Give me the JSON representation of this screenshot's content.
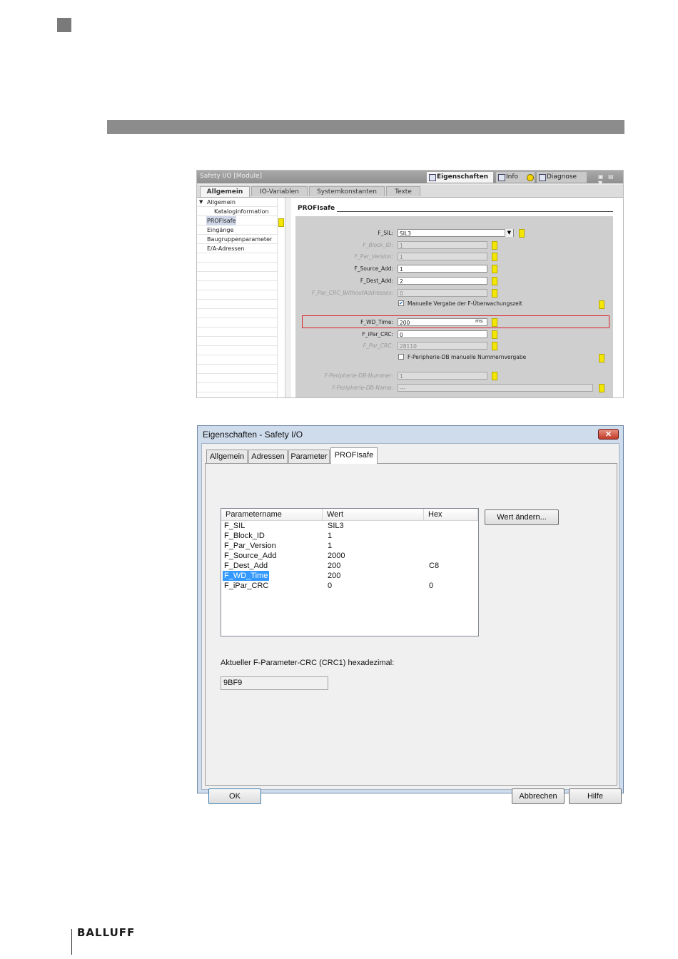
{
  "brand": "BALLUFF",
  "tia": {
    "title": "Safety I/O [Module]",
    "top_tabs": [
      "Eigenschaften",
      "Info",
      "Diagnose"
    ],
    "subtabs": [
      "Allgemein",
      "IO-Variablen",
      "Systemkonstanten",
      "Texte"
    ],
    "tree": [
      "Allgemein",
      "Kataloginformation",
      "PROFIsafe",
      "Eingänge",
      "Baugruppenparameter",
      "E/A-Adressen"
    ],
    "section": "PROFIsafe",
    "params": {
      "f_sil": {
        "label": "F_SIL:",
        "value": "SIL3"
      },
      "f_block_id": {
        "label": "F_Block_ID:",
        "value": "1"
      },
      "f_par_version": {
        "label": "F_Par_Version:",
        "value": "1"
      },
      "f_source_add": {
        "label": "F_Source_Add:",
        "value": "1"
      },
      "f_dest_add": {
        "label": "F_Dest_Add:",
        "value": "2"
      },
      "f_par_crc_wo": {
        "label": "F_Par_CRC_WithoutAddresses:",
        "value": "0"
      },
      "manual_wd_check": "Manuelle Vergabe der F-Überwachungszeit",
      "f_wd_time": {
        "label": "F_WD_Time:",
        "value": "200",
        "unit": "ms"
      },
      "f_ipar_crc": {
        "label": "F_iPar_CRC:",
        "value": "0"
      },
      "f_par_crc": {
        "label": "F_Par_CRC:",
        "value": "28110"
      },
      "db_manual_check": "F-Peripherie-DB manuelle Nummernvergabe",
      "db_number": {
        "label": "F-Peripherie-DB-Nummer:",
        "value": "1"
      },
      "db_name": {
        "label": "F-Peripherie-DB-Name:",
        "value": "---"
      }
    }
  },
  "dialog": {
    "title": "Eigenschaften - Safety I/O",
    "tabs": [
      "Allgemein",
      "Adressen",
      "Parameter",
      "PROFIsafe"
    ],
    "columns": [
      "Parametername",
      "Wert",
      "Hex"
    ],
    "rows": [
      [
        "F_SIL",
        "SIL3",
        ""
      ],
      [
        "F_Block_ID",
        "1",
        ""
      ],
      [
        "F_Par_Version",
        "1",
        ""
      ],
      [
        "F_Source_Add",
        "2000",
        ""
      ],
      [
        "F_Dest_Add",
        "200",
        "C8"
      ],
      [
        "F_WD_Time",
        "200",
        ""
      ],
      [
        "F_iPar_CRC",
        "0",
        "0"
      ]
    ],
    "change_button": "Wert ändern...",
    "crc_label": "Aktueller F-Parameter-CRC (CRC1) hexadezimal:",
    "crc_value": "9BF9",
    "ok": "OK",
    "cancel": "Abbrechen",
    "help": "Hilfe"
  }
}
